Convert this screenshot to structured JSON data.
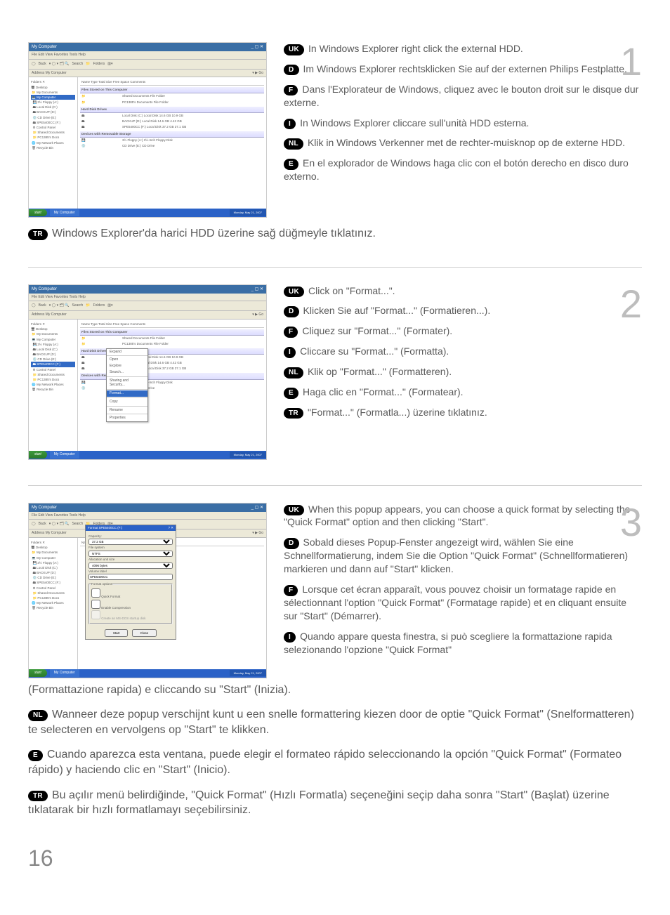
{
  "page_number": "16",
  "step1": {
    "number": "1",
    "uk": "In Windows Explorer right click the external HDD.",
    "d": "Im Windows Explorer rechtsklicken Sie auf der externen Philips Festplatte.",
    "f": "Dans l'Explorateur de Windows, cliquez avec le bouton droit sur le disque dur externe.",
    "i": "In Windows Explorer cliccare sull'unità HDD esterna.",
    "nl": "Klik in Windows Verkenner met de rechter-muisknop op de externe HDD.",
    "e": "En el explorador de Windows haga clic con el botón derecho en disco duro externo.",
    "tr": "Windows Explorer'da harici HDD üzerine sağ düğmeyle tıklatınız."
  },
  "step2": {
    "number": "2",
    "uk": "Click on \"Format...\".",
    "d": "Klicken Sie auf  \"Format...\" (Formatieren...).",
    "f": "Cliquez sur \"Format...\" (Formater).",
    "i": "Cliccare su \"Format...\" (Formatta).",
    "nl": "Klik op \"Format...\" (Formatteren).",
    "e": "Haga clic en \"Format...\" (Formatear).",
    "tr": "\"Format...\" (Formatla...) üzerine tıklatınız."
  },
  "step3": {
    "number": "3",
    "uk": "When this popup appears, you can choose a quick format by selecting the \"Quick Format\" option and then clicking \"Start\".",
    "d": "Sobald dieses Popup-Fenster angezeigt wird, wählen Sie eine Schnellformatierung, indem Sie die Option \"Quick Format\" (Schnellformatieren) markieren und dann auf \"Start\" klicken.",
    "f": "Lorsque cet écran apparaît, vous pouvez choisir un formatage rapide en sélectionnant l'option \"Quick Format\" (Formatage rapide) et en cliquant ensuite sur \"Start\" (Démarrer).",
    "i_part1": "Quando appare questa finestra, si può scegliere la formattazione rapida selezionando l'opzione \"Quick Format\"",
    "i_part2": "(Formattazione rapida) e cliccando su \"Start\" (Inizia).",
    "nl": "Wanneer deze popup verschijnt kunt u een snelle formattering kiezen door de optie \"Quick Format\" (Snelformatteren) te selecteren en vervolgens op \"Start\" te klikken.",
    "e": "Cuando aparezca esta ventana, puede elegir el formateo rápido seleccionando la opción \"Quick Format\" (Formateo rápido) y haciendo clic en \"Start\" (Inicio).",
    "tr": "Bu açılır menü belirdiğinde, \"Quick Format\" (Hızlı Formatla) seçeneğini seçip daha sonra \"Start\" (Başlat) üzerine tıklatarak bir hızlı formatlamayı seçebilirsiniz."
  },
  "badges": {
    "uk": "UK",
    "d": "D",
    "f": "F",
    "i": "I",
    "nl": "NL",
    "e": "E",
    "tr": "TR"
  },
  "screenshot": {
    "title": "My Computer",
    "menu": "File   Edit   View   Favorites   Tools   Help",
    "toolbar_back": "Back",
    "toolbar_search": "Search",
    "toolbar_folders": "Folders",
    "address_label": "Address",
    "address_value": "My Computer",
    "go": "Go",
    "columns": "Name            Type               Total Size     Free Space   Comments",
    "group_files": "Files Stored on This Computer",
    "shared_docs": "Shared Documents   File Folder",
    "user_docs": "PC1385's Documents   File Folder",
    "group_hdd": "Hard Disk Drives",
    "drive_c": "Local Disk (C:)        Local Disk          14.6 GB       10.9 GB",
    "drive_d": "BACKUP (D:)          Local Disk          14.6 GB        4.42 GB",
    "drive_f": "SPE5400CC (F:)      Local Disk          37.2 GB       37.1 GB",
    "group_removable": "Devices with Removable Storage",
    "floppy": "3½ Floppy (A:)       3½-Inch Floppy Disk",
    "cd": "CD Drive (E:)          CD Drive",
    "tree_items": [
      "Desktop",
      "My Documents",
      "My Computer",
      "3½ Floppy (A:)",
      "Local Disk (C:)",
      "BACKUP (D:)",
      "CD Drive (E:)",
      "SPE5400CC (F:)",
      "Control Panel",
      "Shared Documents",
      "PC1385's Documents",
      "My Network Places",
      "Recycle Bin"
    ],
    "start": "start",
    "task": "My Computer",
    "clock": "Monday, May 21, 2007",
    "context_menu": [
      "Open",
      "Explore",
      "Search...",
      "Sharing and Security...",
      "Format...",
      "Copy",
      "Rename",
      "Properties"
    ],
    "context_expand": "Expand",
    "dialog_title": "Format SPE5400CC (F:)",
    "dialog_capacity": "Capacity:",
    "dialog_capacity_val": "37.2 GB",
    "dialog_fs": "File system",
    "dialog_fs_val": "NTFS",
    "dialog_au": "Allocation unit size",
    "dialog_au_val": "4096 bytes",
    "dialog_label": "Volume label",
    "dialog_label_val": "SPE5400CC",
    "dialog_opts": "Format options",
    "dialog_quick": "Quick Format",
    "dialog_compress": "Enable Compression",
    "dialog_msdos": "Create an MS-DOS startup disk",
    "dialog_start": "Start",
    "dialog_close": "Close"
  }
}
